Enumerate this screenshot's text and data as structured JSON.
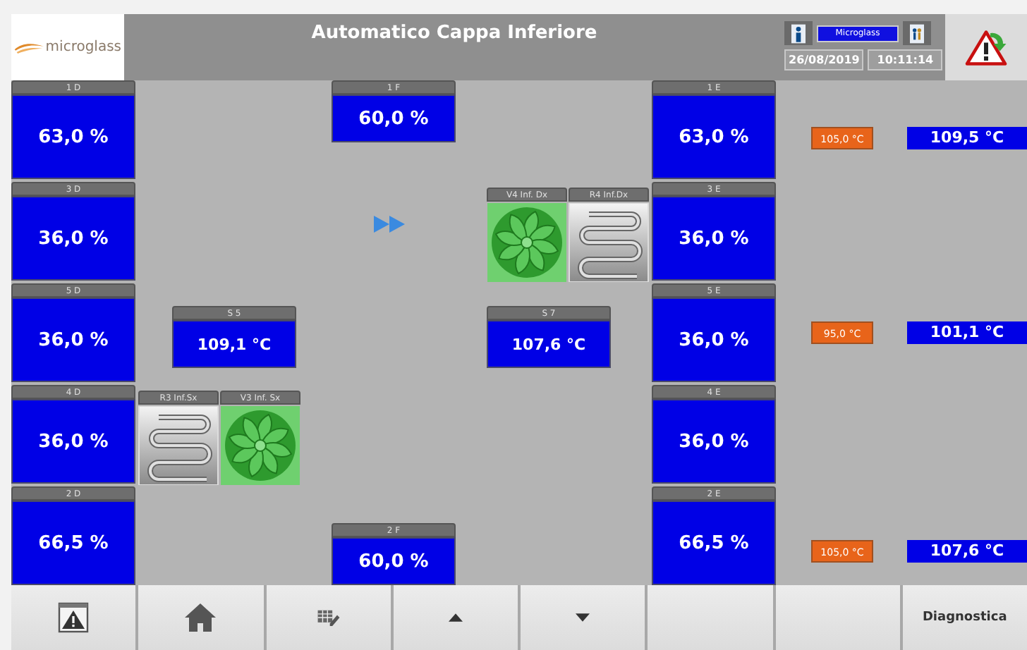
{
  "header": {
    "logo": "microglass",
    "title": "Automatico Cappa Inferiore",
    "user": "Microglass",
    "date": "26/08/2019",
    "time": "10:11:14"
  },
  "left_zones": [
    {
      "label": "1 D",
      "value": "63,0 %"
    },
    {
      "label": "3 D",
      "value": "36,0 %"
    },
    {
      "label": "5 D",
      "value": "36,0 %"
    },
    {
      "label": "4 D",
      "value": "36,0 %"
    },
    {
      "label": "2 D",
      "value": "66,5 %"
    }
  ],
  "right_zones": [
    {
      "label": "1 E",
      "value": "63,0 %"
    },
    {
      "label": "3 E",
      "value": "36,0 %"
    },
    {
      "label": "5 E",
      "value": "36,0 %"
    },
    {
      "label": "4 E",
      "value": "36,0 %"
    },
    {
      "label": "2 E",
      "value": "66,5 %"
    }
  ],
  "fan_speeds": [
    {
      "label": "1 F",
      "value": "60,0 %"
    },
    {
      "label": "2 F",
      "value": "60,0 %"
    }
  ],
  "sensors": [
    {
      "label": "S 5",
      "value": "109,1 °C"
    },
    {
      "label": "S 7",
      "value": "107,6 °C"
    }
  ],
  "devices": [
    {
      "label": "V4 Inf. Dx",
      "kind": "fan"
    },
    {
      "label": "R4 Inf.Dx",
      "kind": "heater"
    },
    {
      "label": "R3 Inf.Sx",
      "kind": "heater"
    },
    {
      "label": "V3 Inf. Sx",
      "kind": "fan"
    }
  ],
  "temperatures": [
    {
      "setpoint": "105,0 °C",
      "reading": "109,5 °C"
    },
    {
      "setpoint": "95,0 °C",
      "reading": "101,1 °C"
    },
    {
      "setpoint": "105,0 °C",
      "reading": "107,6 °C"
    }
  ],
  "footer_buttons": [
    {
      "kind": "alarm"
    },
    {
      "kind": "home"
    },
    {
      "kind": "table"
    },
    {
      "kind": "up"
    },
    {
      "kind": "down"
    },
    {
      "kind": "empty"
    },
    {
      "kind": "empty"
    },
    {
      "kind": "text",
      "label": "Diagnostica"
    }
  ]
}
